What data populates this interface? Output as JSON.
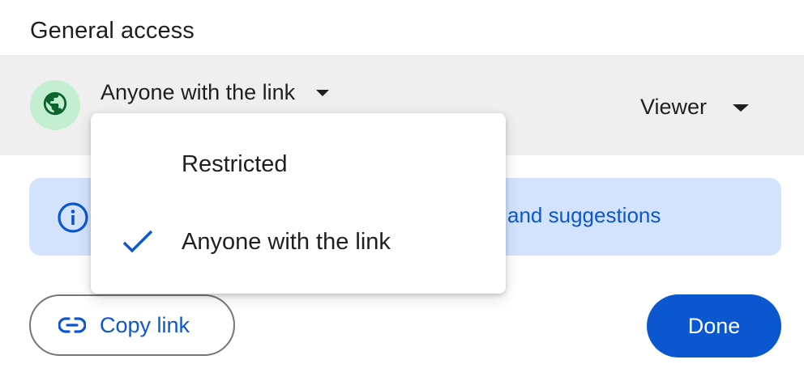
{
  "section": {
    "title": "General access"
  },
  "access": {
    "selected_label": "Anyone with the link",
    "role_label": "Viewer",
    "icon": "globe-icon",
    "icon_bg_color": "#c4eed0",
    "icon_color": "#0d652d"
  },
  "info_banner": {
    "icon": "info-icon",
    "link_text": "and suggestions",
    "bg_color": "#d3e3fd"
  },
  "dropdown": {
    "items": [
      {
        "label": "Restricted",
        "selected": false
      },
      {
        "label": "Anyone with the link",
        "selected": true
      }
    ],
    "check_icon": "check-icon",
    "check_color": "#0b57d0"
  },
  "actions": {
    "copy_link_label": "Copy link",
    "copy_link_icon": "link-icon",
    "done_label": "Done",
    "accent_color": "#0b57d0"
  }
}
